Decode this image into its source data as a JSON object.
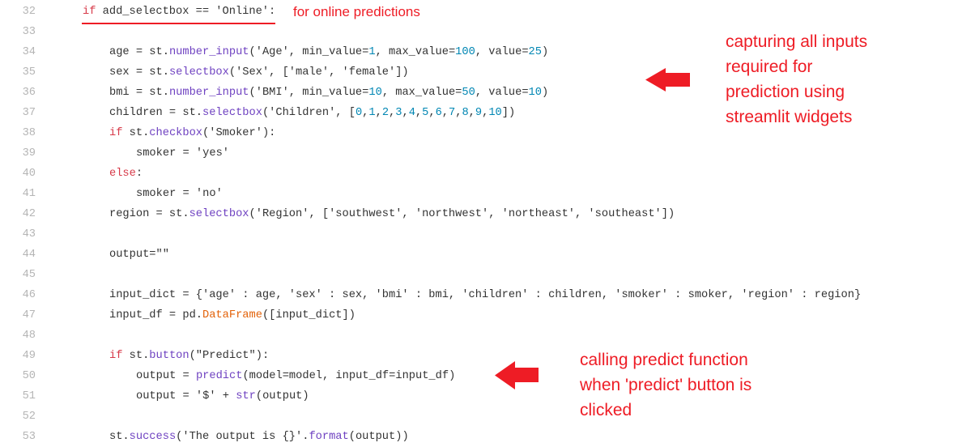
{
  "editor": {
    "lines": [
      {
        "number": "32",
        "indent": 0,
        "tokens": [
          {
            "t": "if",
            "c": "kw"
          },
          {
            "t": " add_selectbox == 'Online':",
            "c": "plain"
          }
        ]
      },
      {
        "number": "33",
        "indent": 0,
        "tokens": []
      },
      {
        "number": "34",
        "indent": 1,
        "tokens": [
          {
            "t": "age = st.",
            "c": "plain"
          },
          {
            "t": "number_input",
            "c": "fn"
          },
          {
            "t": "('Age', min_value=",
            "c": "plain"
          },
          {
            "t": "1",
            "c": "num"
          },
          {
            "t": ", max_value=",
            "c": "plain"
          },
          {
            "t": "100",
            "c": "num"
          },
          {
            "t": ", value=",
            "c": "plain"
          },
          {
            "t": "25",
            "c": "num"
          },
          {
            "t": ")",
            "c": "plain"
          }
        ]
      },
      {
        "number": "35",
        "indent": 1,
        "tokens": [
          {
            "t": "sex = st.",
            "c": "plain"
          },
          {
            "t": "selectbox",
            "c": "fn"
          },
          {
            "t": "('Sex', ['male', 'female'])",
            "c": "plain"
          }
        ]
      },
      {
        "number": "36",
        "indent": 1,
        "tokens": [
          {
            "t": "bmi = st.",
            "c": "plain"
          },
          {
            "t": "number_input",
            "c": "fn"
          },
          {
            "t": "('BMI', min_value=",
            "c": "plain"
          },
          {
            "t": "10",
            "c": "num"
          },
          {
            "t": ", max_value=",
            "c": "plain"
          },
          {
            "t": "50",
            "c": "num"
          },
          {
            "t": ", value=",
            "c": "plain"
          },
          {
            "t": "10",
            "c": "num"
          },
          {
            "t": ")",
            "c": "plain"
          }
        ]
      },
      {
        "number": "37",
        "indent": 1,
        "tokens": [
          {
            "t": "children = st.",
            "c": "plain"
          },
          {
            "t": "selectbox",
            "c": "fn"
          },
          {
            "t": "('Children', [",
            "c": "plain"
          },
          {
            "t": "0",
            "c": "num"
          },
          {
            "t": ",",
            "c": "plain"
          },
          {
            "t": "1",
            "c": "num"
          },
          {
            "t": ",",
            "c": "plain"
          },
          {
            "t": "2",
            "c": "num"
          },
          {
            "t": ",",
            "c": "plain"
          },
          {
            "t": "3",
            "c": "num"
          },
          {
            "t": ",",
            "c": "plain"
          },
          {
            "t": "4",
            "c": "num"
          },
          {
            "t": ",",
            "c": "plain"
          },
          {
            "t": "5",
            "c": "num"
          },
          {
            "t": ",",
            "c": "plain"
          },
          {
            "t": "6",
            "c": "num"
          },
          {
            "t": ",",
            "c": "plain"
          },
          {
            "t": "7",
            "c": "num"
          },
          {
            "t": ",",
            "c": "plain"
          },
          {
            "t": "8",
            "c": "num"
          },
          {
            "t": ",",
            "c": "plain"
          },
          {
            "t": "9",
            "c": "num"
          },
          {
            "t": ",",
            "c": "plain"
          },
          {
            "t": "10",
            "c": "num"
          },
          {
            "t": "])",
            "c": "plain"
          }
        ]
      },
      {
        "number": "38",
        "indent": 1,
        "tokens": [
          {
            "t": "if",
            "c": "kw"
          },
          {
            "t": " st.",
            "c": "plain"
          },
          {
            "t": "checkbox",
            "c": "fn"
          },
          {
            "t": "('Smoker'):",
            "c": "plain"
          }
        ]
      },
      {
        "number": "39",
        "indent": 2,
        "tokens": [
          {
            "t": "smoker = 'yes'",
            "c": "plain"
          }
        ]
      },
      {
        "number": "40",
        "indent": 1,
        "tokens": [
          {
            "t": "else",
            "c": "kw"
          },
          {
            "t": ":",
            "c": "plain"
          }
        ]
      },
      {
        "number": "41",
        "indent": 2,
        "tokens": [
          {
            "t": "smoker = 'no'",
            "c": "plain"
          }
        ]
      },
      {
        "number": "42",
        "indent": 1,
        "tokens": [
          {
            "t": "region = st.",
            "c": "plain"
          },
          {
            "t": "selectbox",
            "c": "fn"
          },
          {
            "t": "('Region', ['southwest', 'northwest', 'northeast', 'southeast'])",
            "c": "plain"
          }
        ]
      },
      {
        "number": "43",
        "indent": 0,
        "tokens": []
      },
      {
        "number": "44",
        "indent": 1,
        "tokens": [
          {
            "t": "output=\"\"",
            "c": "plain"
          }
        ]
      },
      {
        "number": "45",
        "indent": 0,
        "tokens": []
      },
      {
        "number": "46",
        "indent": 1,
        "tokens": [
          {
            "t": "input_dict = {'age' : age, 'sex' : sex, 'bmi' : bmi, 'children' : children, 'smoker' : smoker, 'region' : region}",
            "c": "plain"
          }
        ]
      },
      {
        "number": "47",
        "indent": 1,
        "tokens": [
          {
            "t": "input_df = pd.",
            "c": "plain"
          },
          {
            "t": "DataFrame",
            "c": "cls"
          },
          {
            "t": "([input_dict])",
            "c": "plain"
          }
        ]
      },
      {
        "number": "48",
        "indent": 0,
        "tokens": []
      },
      {
        "number": "49",
        "indent": 1,
        "tokens": [
          {
            "t": "if",
            "c": "kw"
          },
          {
            "t": " st.",
            "c": "plain"
          },
          {
            "t": "button",
            "c": "fn"
          },
          {
            "t": "(\"Predict\"):",
            "c": "plain"
          }
        ]
      },
      {
        "number": "50",
        "indent": 2,
        "tokens": [
          {
            "t": "output = ",
            "c": "plain"
          },
          {
            "t": "predict",
            "c": "fn"
          },
          {
            "t": "(model=model, input_df=input_df)",
            "c": "plain"
          }
        ]
      },
      {
        "number": "51",
        "indent": 2,
        "tokens": [
          {
            "t": "output = '$' + ",
            "c": "plain"
          },
          {
            "t": "str",
            "c": "fn"
          },
          {
            "t": "(output)",
            "c": "plain"
          }
        ]
      },
      {
        "number": "52",
        "indent": 0,
        "tokens": []
      },
      {
        "number": "53",
        "indent": 1,
        "tokens": [
          {
            "t": "st.",
            "c": "plain"
          },
          {
            "t": "success",
            "c": "fn"
          },
          {
            "t": "('The output is {}'.",
            "c": "plain"
          },
          {
            "t": "format",
            "c": "fn"
          },
          {
            "t": "(output))",
            "c": "plain"
          }
        ]
      }
    ]
  },
  "annotations": {
    "online": "for online predictions",
    "capture": [
      "capturing all inputs",
      "required for",
      "prediction using",
      "streamlit widgets"
    ],
    "predict": [
      "calling predict function",
      "when 'predict' button is",
      "clicked"
    ],
    "color": "#ee1c25"
  },
  "icons": {
    "arrow_capture": "left-arrow-icon",
    "arrow_predict": "left-arrow-icon"
  }
}
